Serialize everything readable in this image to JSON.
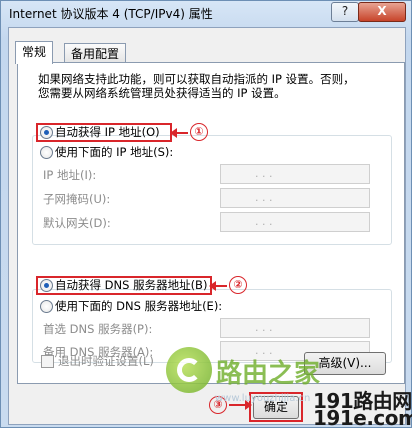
{
  "window": {
    "title": "Internet 协议版本 4 (TCP/IPv4) 属性",
    "help_label": "?",
    "close_label": "X"
  },
  "tabs": [
    {
      "label": "常规"
    },
    {
      "label": "备用配置"
    }
  ],
  "description_line1": "如果网络支持此功能，则可以获取自动指派的 IP 设置。否则，",
  "description_line2": "您需要从网络系统管理员处获得适当的 IP 设置。",
  "ip_section": {
    "auto_label": "自动获得 IP 地址(O)",
    "manual_label": "使用下面的 IP 地址(S):",
    "fields": [
      {
        "label": "IP 地址(I):"
      },
      {
        "label": "子网掩码(U):"
      },
      {
        "label": "默认网关(D):"
      }
    ]
  },
  "dns_section": {
    "auto_label": "自动获得 DNS 服务器地址(B)",
    "manual_label": "使用下面的 DNS 服务器地址(E):",
    "fields": [
      {
        "label": "首选 DNS 服务器(P):"
      },
      {
        "label": "备用 DNS 服务器(A):"
      }
    ]
  },
  "validate_label": "退出时验证设置(L)",
  "advanced_label": "高级(V)...",
  "ok_label": "确定",
  "callouts": [
    "①",
    "②",
    "③"
  ],
  "ip_dots": ".    .    .",
  "watermark": {
    "brand": "路由之家",
    "url": "www.luyouzhijia.cn",
    "line1": "191路由网",
    "line2": "191e.com"
  },
  "colors": {
    "highlight": "#d9262b",
    "radio_on": "#1f5fb8"
  }
}
